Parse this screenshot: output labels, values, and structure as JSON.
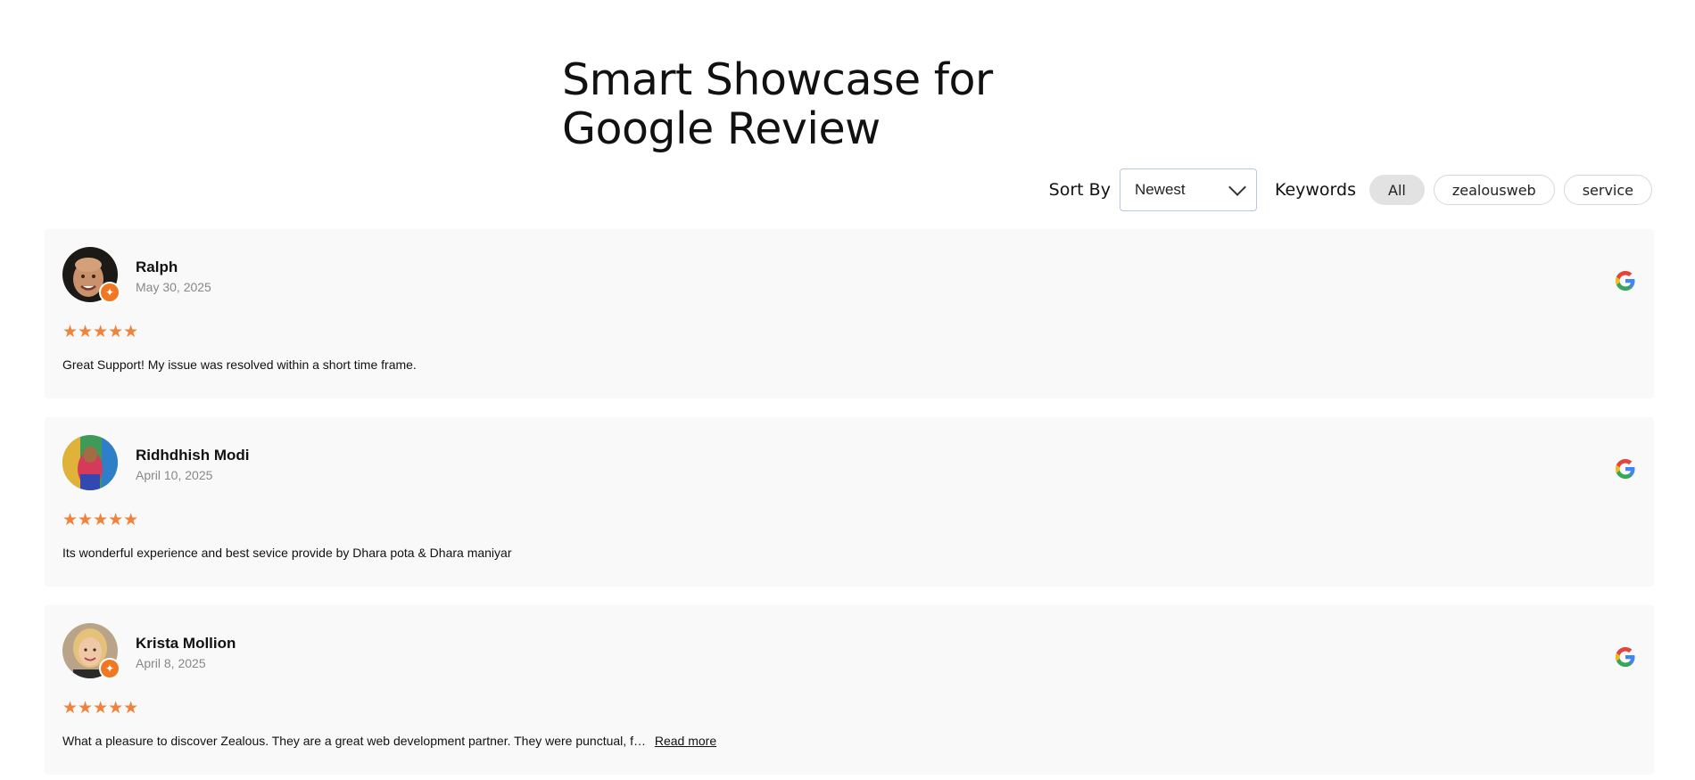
{
  "title": {
    "line1": "Smart Showcase for",
    "line2": "Google Review"
  },
  "toolbar": {
    "sort_label": "Sort By",
    "sort_value": "Newest",
    "keywords_label": "Keywords",
    "keywords": [
      "All",
      "zealousweb",
      "service"
    ],
    "active_keyword": "All"
  },
  "colors": {
    "star": "#f0823a",
    "badge": "#f07822",
    "card_bg": "#f9f9f9"
  },
  "reviews": [
    {
      "name": "Ralph",
      "date": "May 30, 2025",
      "rating": 5,
      "stars": "★★★★★",
      "text": "Great Support! My issue was resolved within a short time frame.",
      "has_badge": true,
      "read_more": ""
    },
    {
      "name": "Ridhdhish Modi",
      "date": "April 10, 2025",
      "rating": 5,
      "stars": "★★★★★",
      "text": "Its wonderful experience and best sevice provide by Dhara pota & Dhara maniyar",
      "has_badge": false,
      "read_more": ""
    },
    {
      "name": "Krista Mollion",
      "date": "April 8, 2025",
      "rating": 5,
      "stars": "★★★★★",
      "text": "What a pleasure to discover Zealous. They are a great web development partner. They were punctual, f…",
      "has_badge": true,
      "read_more": "Read more"
    }
  ]
}
